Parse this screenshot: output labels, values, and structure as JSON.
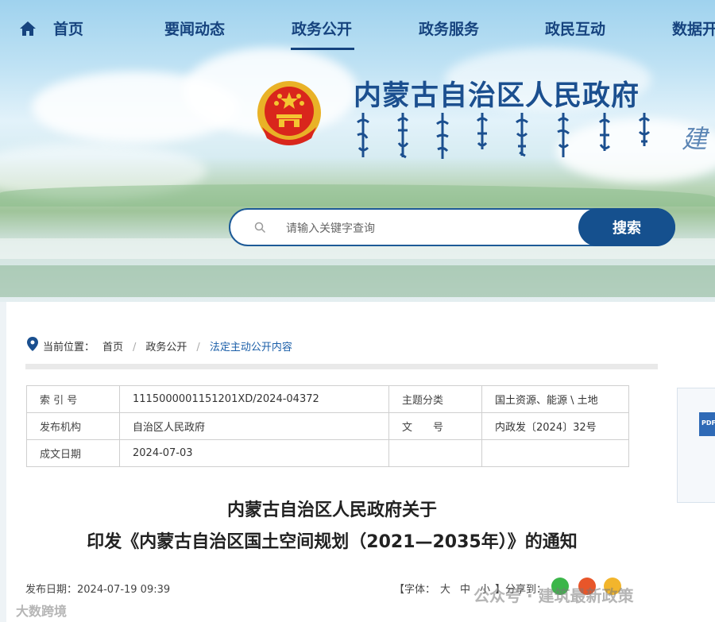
{
  "nav": {
    "items": [
      "首页",
      "要闻动态",
      "政务公开",
      "政务服务",
      "政民互动",
      "数据开"
    ],
    "active": "政务公开"
  },
  "header": {
    "title": "内蒙古自治区人民政府",
    "edge_script": "建"
  },
  "search": {
    "placeholder": "请输入关键字查询",
    "button": "搜索"
  },
  "breadcrumb": {
    "label": "当前位置：",
    "items": [
      "首页",
      "政务公开",
      "法定主动公开内容"
    ]
  },
  "meta": {
    "rows": [
      [
        "索 引 号",
        "1115000001151201XD/2024-04372",
        "主题分类",
        "国土资源、能源 \\ 土地"
      ],
      [
        "发布机构",
        "自治区人民政府",
        "文　　号",
        "内政发〔2024〕32号"
      ],
      [
        "成文日期",
        "2024-07-03",
        "",
        ""
      ]
    ]
  },
  "sidebar_card": {
    "icon_text": "PDF"
  },
  "document": {
    "title_line1": "内蒙古自治区人民政府关于",
    "title_line2": "印发《内蒙古自治区国土空间规划（2021—2035年）》的通知",
    "published": "发布日期：2024-07-19 09:39",
    "font_label": "【字体：",
    "font_sizes": [
      "大",
      "中",
      "小"
    ],
    "font_close": "】",
    "share_label": "分享到："
  },
  "watermark": {
    "left": "大数跨境",
    "right": "公众号 · 建筑最新政策"
  },
  "colors": {
    "brand": "#16437e",
    "search_button": "#15508e",
    "link": "#1a5ea8"
  }
}
